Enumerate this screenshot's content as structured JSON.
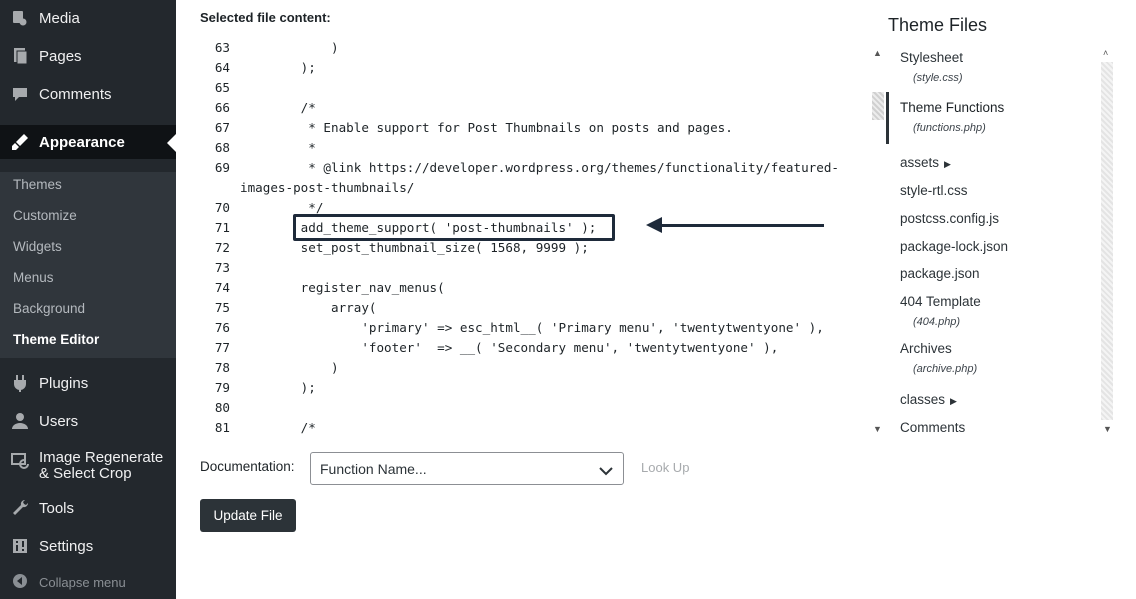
{
  "sidebar": {
    "items": [
      {
        "label": "Media",
        "icon": "media-icon"
      },
      {
        "label": "Pages",
        "icon": "pages-icon"
      },
      {
        "label": "Comments",
        "icon": "comments-icon"
      },
      {
        "label": "Appearance",
        "icon": "appearance-icon"
      },
      {
        "label": "Plugins",
        "icon": "plugins-icon"
      },
      {
        "label": "Users",
        "icon": "users-icon"
      },
      {
        "label": "Image Regenerate",
        "label2": "& Select Crop",
        "icon": "image-regenerate-icon"
      },
      {
        "label": "Tools",
        "icon": "tools-icon"
      },
      {
        "label": "Settings",
        "icon": "settings-icon"
      }
    ],
    "submenu": [
      "Themes",
      "Customize",
      "Widgets",
      "Menus",
      "Background",
      "Theme Editor"
    ],
    "collapse_label": "Collapse menu"
  },
  "editor": {
    "selected_label": "Selected file content:",
    "lines": [
      {
        "n": "63",
        "code": "            )"
      },
      {
        "n": "64",
        "code": "        );"
      },
      {
        "n": "65",
        "code": ""
      },
      {
        "n": "66",
        "code": "        /*"
      },
      {
        "n": "67",
        "code": "         * Enable support for Post Thumbnails on posts and pages."
      },
      {
        "n": "68",
        "code": "         *"
      },
      {
        "n": "69",
        "code": "         * @link https://developer.wordpress.org/themes/functionality/featured-"
      },
      {
        "n": "",
        "code": "images-post-thumbnails/",
        "wrap": true
      },
      {
        "n": "70",
        "code": "         */"
      },
      {
        "n": "71",
        "code": "        add_theme_support( 'post-thumbnails' );"
      },
      {
        "n": "72",
        "code": "        set_post_thumbnail_size( 1568, 9999 );"
      },
      {
        "n": "73",
        "code": ""
      },
      {
        "n": "74",
        "code": "        register_nav_menus("
      },
      {
        "n": "75",
        "code": "            array("
      },
      {
        "n": "76",
        "code": "                'primary' => esc_html__( 'Primary menu', 'twentytwentyone' ),"
      },
      {
        "n": "77",
        "code": "                'footer'  => __( 'Secondary menu', 'twentytwentyone' ),"
      },
      {
        "n": "78",
        "code": "            )"
      },
      {
        "n": "79",
        "code": "        );"
      },
      {
        "n": "80",
        "code": ""
      },
      {
        "n": "81",
        "code": "        /*"
      }
    ]
  },
  "documentation": {
    "label": "Documentation:",
    "select_value": "Function Name...",
    "lookup_label": "Look Up"
  },
  "update_button": "Update File",
  "theme_files": {
    "title": "Theme Files",
    "files": [
      {
        "name": "Stylesheet",
        "sub": "(style.css)"
      },
      {
        "name": "Theme Functions",
        "sub": "(functions.php)",
        "current": true
      },
      {
        "name": "assets",
        "dir": true
      },
      {
        "name": "style-rtl.css"
      },
      {
        "name": "postcss.config.js"
      },
      {
        "name": "package-lock.json"
      },
      {
        "name": "package.json"
      },
      {
        "name": "404 Template",
        "sub": "(404.php)"
      },
      {
        "name": "Archives",
        "sub": "(archive.php)"
      },
      {
        "name": "classes",
        "dir": true
      },
      {
        "name": "Comments"
      }
    ]
  },
  "colors": {
    "sidebar_bg": "#23282d",
    "submenu_bg": "#30363c",
    "button_bg": "#2c3338",
    "highlight": "#1e2a3a"
  }
}
